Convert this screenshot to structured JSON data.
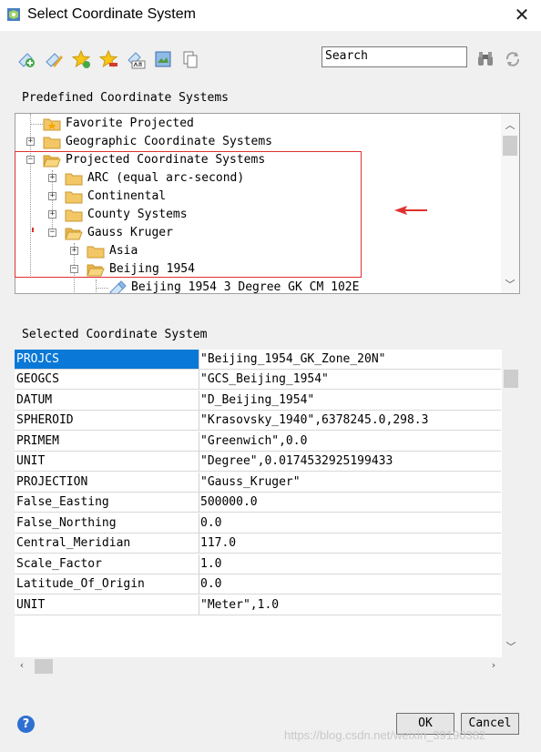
{
  "window": {
    "title": "Select Coordinate System",
    "close_label": "✕"
  },
  "toolbar": {
    "icons": [
      "add-coordinate-icon",
      "edit-coordinate-icon",
      "add-favorite-icon",
      "remove-favorite-icon",
      "rename-icon",
      "import-icon",
      "copy-icon",
      "binoculars-icon",
      "refresh-icon"
    ],
    "search_value": "Search"
  },
  "predefined_label": "Predefined Coordinate Systems",
  "tree": {
    "items": [
      {
        "label": "Favorite Projected",
        "level": 0,
        "expander": "",
        "icon": "favorite-folder"
      },
      {
        "label": "Geographic Coordinate Systems",
        "level": 0,
        "expander": "+",
        "icon": "folder"
      },
      {
        "label": "Projected Coordinate Systems",
        "level": 0,
        "expander": "−",
        "icon": "folder-open"
      },
      {
        "label": "ARC (equal arc-second)",
        "level": 1,
        "expander": "+",
        "icon": "folder"
      },
      {
        "label": "Continental",
        "level": 1,
        "expander": "+",
        "icon": "folder"
      },
      {
        "label": "County Systems",
        "level": 1,
        "expander": "+",
        "icon": "folder"
      },
      {
        "label": "Gauss Kruger",
        "level": 1,
        "expander": "−",
        "icon": "folder-open"
      },
      {
        "label": "Asia",
        "level": 2,
        "expander": "+",
        "icon": "folder"
      },
      {
        "label": "Beijing 1954",
        "level": 2,
        "expander": "−",
        "icon": "folder-open"
      },
      {
        "label": "Beijing 1954 3 Degree GK CM 102E",
        "level": 3,
        "expander": "",
        "icon": "projection-file"
      }
    ]
  },
  "annotation": {
    "arrow_color": "#e03030",
    "box_color": "#e03030"
  },
  "selected_label": "Selected Coordinate System",
  "properties": [
    {
      "key": "PROJCS",
      "value": "\"Beijing_1954_GK_Zone_20N\""
    },
    {
      "key": "GEOGCS",
      "value": "\"GCS_Beijing_1954\""
    },
    {
      "key": "DATUM",
      "value": "\"D_Beijing_1954\""
    },
    {
      "key": "SPHEROID",
      "value": "\"Krasovsky_1940\",6378245.0,298.3"
    },
    {
      "key": "PRIMEM",
      "value": "\"Greenwich\",0.0"
    },
    {
      "key": "UNIT",
      "value": "\"Degree\",0.0174532925199433"
    },
    {
      "key": "PROJECTION",
      "value": "\"Gauss_Kruger\""
    },
    {
      "key": "False_Easting",
      "value": "500000.0"
    },
    {
      "key": "False_Northing",
      "value": "0.0"
    },
    {
      "key": "Central_Meridian",
      "value": "117.0"
    },
    {
      "key": "Scale_Factor",
      "value": "1.0"
    },
    {
      "key": "Latitude_Of_Origin",
      "value": "0.0"
    },
    {
      "key": "UNIT",
      "value": "\"Meter\",1.0"
    }
  ],
  "buttons": {
    "ok": "OK",
    "cancel": "Cancel"
  },
  "watermark": "https://blog.csdn.net/weixin_39190382",
  "colors": {
    "selection": "#0a78d7",
    "folder": "#f3c766"
  }
}
